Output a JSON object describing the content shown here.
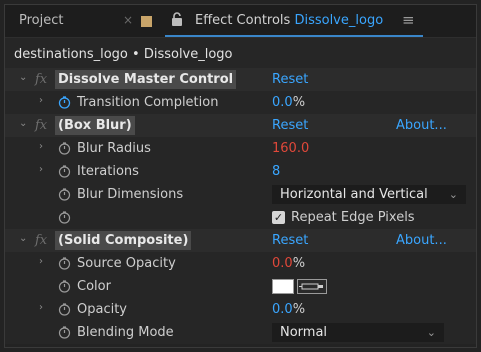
{
  "tabbar": {
    "project_label": "Project",
    "close_glyph": "×",
    "swatch_color": "#c9a56a",
    "title_prefix": "Effect Controls ",
    "title_comp": "Dissolve_logo",
    "menu_glyph": "≡",
    "lock_icon": "lock-icon"
  },
  "subheader": {
    "path": "destinations_logo • Dissolve_logo"
  },
  "colors": {
    "accent": "#3aa6ff",
    "keyed_red": "#e0483a",
    "underline": "#3a86c9"
  },
  "effects": [
    {
      "name": "Dissolve Master Control",
      "fx": "fx",
      "reset": "Reset",
      "about": "",
      "props": [
        {
          "label": "Transition Completion",
          "value": "0.0",
          "unit": "%"
        }
      ]
    },
    {
      "name": "(Box Blur)",
      "fx": "fx",
      "reset": "Reset",
      "about": "About...",
      "props": [
        {
          "label": "Blur Radius",
          "value": "160.0"
        },
        {
          "label": "Iterations",
          "value": "8"
        },
        {
          "label": "Blur Dimensions",
          "dropdown": "Horizontal and Vertical"
        },
        {
          "checkbox_label": "Repeat Edge Pixels",
          "checked": true
        }
      ]
    },
    {
      "name": "(Solid Composite)",
      "fx": "fx",
      "reset": "Reset",
      "about": "About...",
      "props": [
        {
          "label": "Source Opacity",
          "value": "0.0",
          "unit": "%"
        },
        {
          "label": "Color",
          "color": "#ffffff"
        },
        {
          "label": "Opacity",
          "value": "0.0",
          "unit": "%"
        },
        {
          "label": "Blending Mode",
          "dropdown": "Normal"
        }
      ]
    }
  ],
  "glyphs": {
    "chevron_right": "›",
    "chevron_down": "⌄",
    "check": "✓",
    "caret": "⌄"
  }
}
